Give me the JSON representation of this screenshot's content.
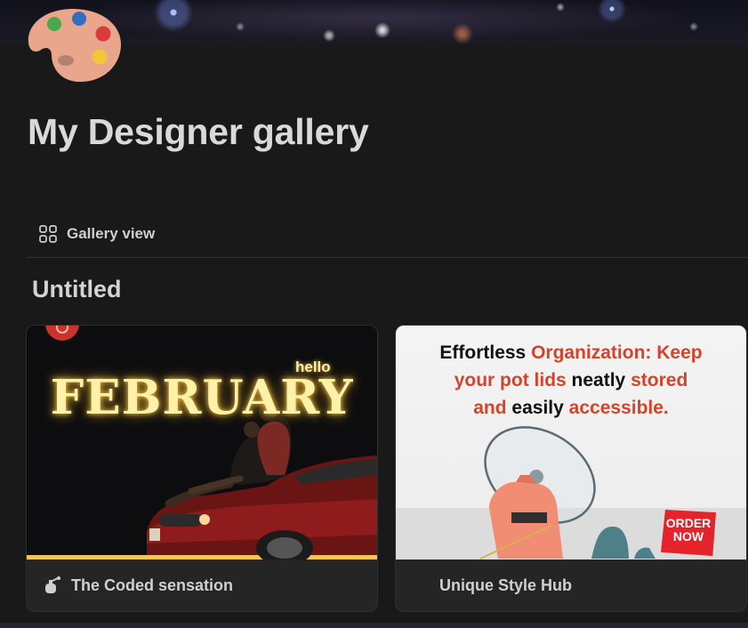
{
  "page": {
    "title": "My Designer gallery",
    "icon": "artist-palette-icon"
  },
  "views": {
    "active_label": "Gallery view",
    "icon": "gallery-grid-icon"
  },
  "group": {
    "title": "Untitled"
  },
  "cards": [
    {
      "label": "The Coded sensation",
      "icon": "perfume-bottle-icon",
      "cover": {
        "headline": "FEBRUARY",
        "accent": "hello"
      }
    },
    {
      "label": "Unique Style Hub",
      "cover": {
        "line1_black": "Effortless",
        "line1_red": "Organization: Keep",
        "line2_red_a": "your pot lids",
        "line2_black": "neatly",
        "line2_red_b": "stored",
        "line3_red_a": "and",
        "line3_black": "easily",
        "line3_red_b": "accessible.",
        "badge": "ORDER NOW"
      }
    }
  ],
  "colors": {
    "background": "#191919",
    "card": "#252525",
    "accent_red": "#d6432a",
    "glow_yellow": "#fff1a8"
  }
}
